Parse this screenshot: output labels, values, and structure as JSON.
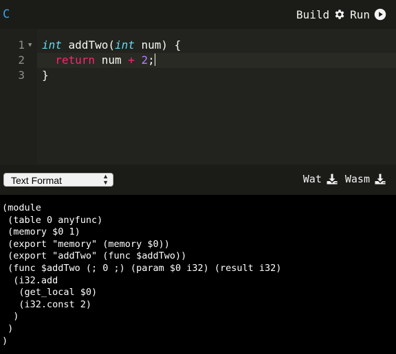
{
  "header": {
    "language": "C",
    "build_label": "Build",
    "run_label": "Run"
  },
  "editor": {
    "line_numbers": [
      "1",
      "2",
      "3"
    ]
  },
  "output_panel": {
    "format_select_value": "Text Format",
    "wat_label": "Wat",
    "wasm_label": "Wasm",
    "lines": [
      "(module",
      " (table 0 anyfunc)",
      " (memory $0 1)",
      " (export \"memory\" (memory $0))",
      " (export \"addTwo\" (func $addTwo))",
      " (func $addTwo (; 0 ;) (param $0 i32) (result i32)",
      "  (i32.add",
      "   (get_local $0)",
      "   (i32.const 2)",
      "  )",
      " )",
      ")"
    ]
  },
  "icons": {
    "build": "gear-icon",
    "run": "play-circle-icon",
    "download": "download-icon"
  }
}
